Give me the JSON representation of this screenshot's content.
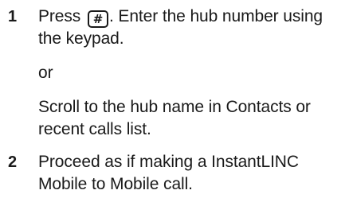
{
  "steps": [
    {
      "number": "1",
      "press_label": "Press",
      "key_symbol": "#",
      "line1_rest": ". Enter the hub number using",
      "line2": "the keypad.",
      "or_text": "or",
      "alt_line1": "Scroll to the hub name in Contacts or",
      "alt_line2": "recent calls list."
    },
    {
      "number": "2",
      "line1": "Proceed as if making a InstantLINC",
      "line2": "Mobile to Mobile call."
    }
  ],
  "icons": {
    "key": "pound-key-icon"
  }
}
